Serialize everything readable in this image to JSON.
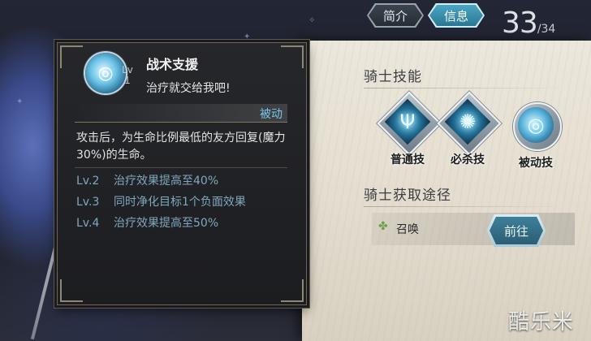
{
  "tabs": [
    {
      "label": "简介",
      "active": false
    },
    {
      "label": "信息",
      "active": true
    }
  ],
  "counter": {
    "current": "33",
    "total": "/34"
  },
  "skill_tooltip": {
    "level_badge": "Lv\n1",
    "name": "战术支援",
    "quote": "治疗就交给我吧!",
    "type": "被动",
    "description": "攻击后，为生命比例最低的友方回复(魔力30%)的生命。",
    "upgrades": [
      {
        "level": "Lv.2",
        "effect": "治疗效果提高至40%"
      },
      {
        "level": "Lv.3",
        "effect": "同时净化目标1个负面效果"
      },
      {
        "level": "Lv.4",
        "effect": "治疗效果提高至50%"
      }
    ]
  },
  "knight_skills": {
    "title": "骑士技能",
    "skills": [
      {
        "label": "普通技",
        "icon": "trident-icon"
      },
      {
        "label": "必杀技",
        "icon": "figure-burst-icon"
      },
      {
        "label": "被动技",
        "icon": "swirl-icon"
      }
    ]
  },
  "acquire": {
    "title": "骑士获取途径",
    "source": "召唤",
    "go_label": "前往"
  },
  "watermark": "酷乐米",
  "colors": {
    "passive_blue": "#78c8ec",
    "upgrade_text": "#7fa8bd",
    "active_tab": "#2b7794",
    "parchment": "#e4ddcf"
  }
}
